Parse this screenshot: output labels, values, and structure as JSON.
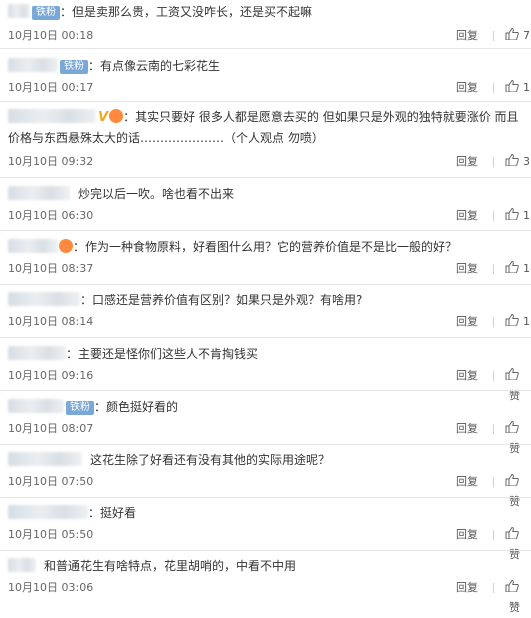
{
  "comments": [
    {
      "text": "：但是卖那么贵，工资又没咋长，还是买不起嘛",
      "badge": "铁粉",
      "date": "10月10日 00:18",
      "reply_label": "回复",
      "like": "7"
    },
    {
      "text": "：有点像云南的七彩花生",
      "badge": "铁粉",
      "date": "10月10日 00:17",
      "reply_label": "回复",
      "like": "1"
    },
    {
      "text": "：其实只要好 很多人都是愿意去买的 但如果只是外观的独特就要涨价 而且价格与东西悬殊太大的话…………………（个人观点 勿喷）",
      "vip_mark": "V",
      "date": "10月10日 09:32",
      "reply_label": "回复",
      "like": "3"
    },
    {
      "text": "炒完以后一吹。啥也看不出来",
      "date": "10月10日 06:30",
      "reply_label": "回复",
      "like": "1"
    },
    {
      "text": "：作为一种食物原料，好看图什么用？它的营养价值是不是比一般的好？",
      "date": "10月10日 08:37",
      "reply_label": "回复",
      "like": "1"
    },
    {
      "text": "：口感还是营养价值有区别？如果只是外观？有啥用?",
      "date": "10月10日 08:14",
      "reply_label": "回复",
      "like": "1"
    },
    {
      "text": "：主要还是怪你们这些人不肯掏钱买",
      "date": "10月10日 09:16",
      "reply_label": "回复",
      "like": "赞"
    },
    {
      "text": "：颜色挺好看的",
      "badge": "铁粉",
      "date": "10月10日 08:07",
      "reply_label": "回复",
      "like": "赞"
    },
    {
      "text": "这花生除了好看还有没有其他的实际用途呢？",
      "date": "10月10日 07:50",
      "reply_label": "回复",
      "like": "赞"
    },
    {
      "text": "：挺好看",
      "date": "10月10日 05:50",
      "reply_label": "回复",
      "like": "赞"
    },
    {
      "text": "和普通花生有啥特点，花里胡哨的，中看不中用",
      "date": "10月10日 03:06",
      "reply_label": "回复",
      "like": "赞"
    }
  ]
}
